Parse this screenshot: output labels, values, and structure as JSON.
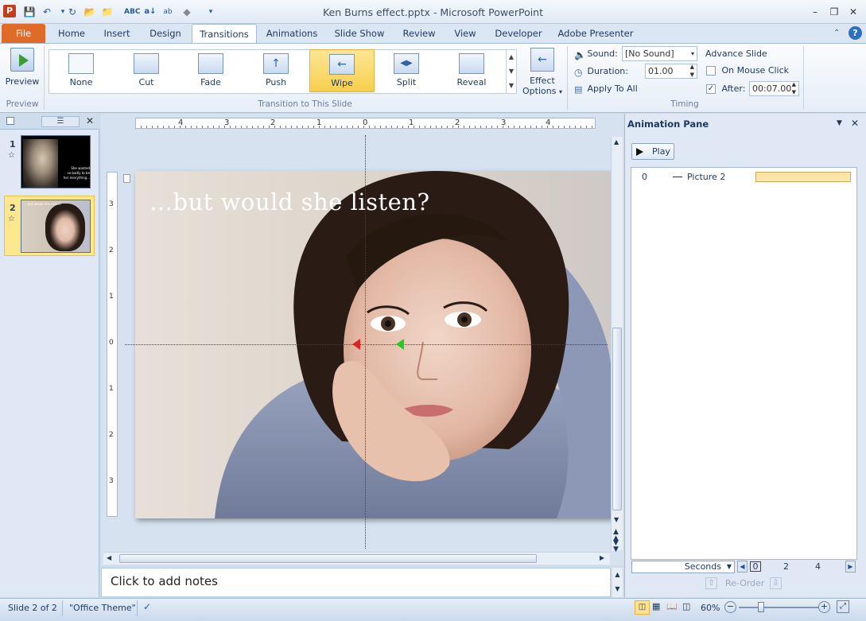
{
  "window": {
    "title": "Ken Burns effect.pptx - Microsoft PowerPoint"
  },
  "quick_access": [
    "save-icon",
    "undo-icon",
    "redo-icon",
    "open-icon",
    "folder-icon",
    "spelling-icon",
    "abc-icon",
    "autocorrect-icon",
    "shapes-icon",
    "customize-icon"
  ],
  "tabs": [
    "File",
    "Home",
    "Insert",
    "Design",
    "Transitions",
    "Animations",
    "Slide Show",
    "Review",
    "View",
    "Developer",
    "Adobe Presenter"
  ],
  "active_tab": "Transitions",
  "ribbon": {
    "preview": {
      "label": "Preview",
      "group_label": "Preview"
    },
    "transitions": {
      "items": [
        "None",
        "Cut",
        "Fade",
        "Push",
        "Wipe",
        "Split",
        "Reveal"
      ],
      "selected": "Wipe",
      "group_label": "Transition to This Slide"
    },
    "effect_options": {
      "label1": "Effect",
      "label2": "Options"
    },
    "timing": {
      "sound_label": "Sound:",
      "sound_value": "[No Sound]",
      "duration_label": "Duration:",
      "duration_value": "01.00",
      "apply_all_label": "Apply To All",
      "advance_label": "Advance Slide",
      "on_mouse_click_label": "On Mouse Click",
      "on_mouse_click_checked": false,
      "after_label": "After:",
      "after_checked": true,
      "after_value": "00:07.00",
      "group_label": "Timing"
    }
  },
  "slides_pane": {
    "slides": [
      {
        "number": "1",
        "caption_lines": [
          "She wanted",
          "so badly to be",
          "her everything..."
        ]
      },
      {
        "number": "2",
        "caption_lines": [
          "...but would she listen?"
        ]
      }
    ],
    "selected": "2"
  },
  "ruler": {
    "h_labels": [
      "4",
      "3",
      "2",
      "1",
      "0",
      "1",
      "2",
      "3",
      "4"
    ],
    "v_labels": [
      "3",
      "2",
      "1",
      "0",
      "1",
      "2",
      "3"
    ]
  },
  "slide": {
    "caption": "…but would she listen?"
  },
  "notes": {
    "placeholder": "Click to add notes"
  },
  "animation_pane": {
    "title": "Animation Pane",
    "play_label": "Play",
    "items": [
      {
        "index": "0",
        "name": "Picture 2"
      }
    ],
    "timeline_unit": "Seconds",
    "timeline_ticks": [
      "0",
      "2",
      "4"
    ],
    "reorder_label": "Re-Order"
  },
  "status": {
    "slide_info": "Slide 2 of 2",
    "theme": "\"Office Theme\"",
    "zoom": "60%"
  },
  "colors": {
    "accent_file_tab": "#e06b28",
    "selected_gallery": "#f8cf4d",
    "animation_bar": "#fde6a8"
  }
}
